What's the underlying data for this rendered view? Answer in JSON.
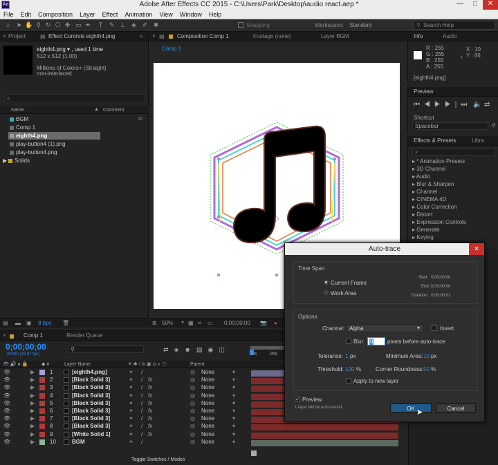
{
  "window": {
    "title": "Adobe After Effects CC 2015 - C:\\Users\\Park\\Desktop\\audio react.aep *",
    "app_icon": "Ae",
    "minimize": "—",
    "maximize": "□",
    "close": "✕"
  },
  "menu": [
    "File",
    "Edit",
    "Composition",
    "Layer",
    "Effect",
    "Animation",
    "View",
    "Window",
    "Help"
  ],
  "toolbar": {
    "snapping": "Snapping",
    "workspace_label": "Workspace:",
    "workspace_value": "Standard",
    "search_placeholder": "Search Help"
  },
  "project_panel": {
    "tabs": [
      "Project",
      "Effect Controls eighth4.png"
    ],
    "file_name": "eighth4.png ▾ , used 1 time",
    "file_dims": "512 x 512 (1.00)",
    "file_color": "Millions of Colors+ (Straight)",
    "file_interlace": "non-interlaced",
    "search_glyph": "⌕",
    "col_name": "Name",
    "col_comment": "Comment",
    "items": [
      {
        "name": "BGM",
        "color": "#3fa8a8"
      },
      {
        "name": "Comp 1",
        "color": "#8a8a8a"
      },
      {
        "name": "eighth4.png",
        "color": "#8a8a8a"
      },
      {
        "name": "play-button4 (1).png",
        "color": "#8a8a8a"
      },
      {
        "name": "play-button4.png",
        "color": "#8a8a8a"
      },
      {
        "name": "Solids",
        "color": "#8a8a8a"
      }
    ],
    "bpc": "8 bpc"
  },
  "comp_panel": {
    "tabs": [
      "Composition Comp 1",
      "Footage (none)",
      "Layer BGM"
    ],
    "breadcrumb": "Comp 1",
    "zoom": "50%",
    "timecode": "0;00;00;00"
  },
  "info_panel": {
    "tabs": [
      "Info",
      "Audio"
    ],
    "r": "R : 255",
    "g": "G : 255",
    "b": "B : 255",
    "a": "A : 255",
    "x": "X : 10",
    "y": "Y : 66",
    "file": "[eighth4.png]"
  },
  "preview_panel": {
    "tab": "Preview",
    "shortcut_label": "Shortcut",
    "shortcut_value": "Spacebar"
  },
  "effects_panel": {
    "tabs": [
      "Effects & Presets",
      "Libra"
    ],
    "search_glyph": "⌕",
    "items": [
      "* Animation Presets",
      "3D Channel",
      "Audio",
      "Blur & Sharpen",
      "Channel",
      "CINEMA 4D",
      "Color Correction",
      "Distort",
      "Expression Controls",
      "Generate",
      "Keying"
    ]
  },
  "timeline": {
    "tabs": [
      "Comp 1",
      "Render Queue"
    ],
    "timecode": "0;00;00;00",
    "fps": "00000 (29.97 fps)",
    "col_layer": "Layer Name",
    "col_parent": "Parent",
    "ruler": [
      "0s",
      "05s"
    ],
    "footer": "Toggle Switches / Modes",
    "layers": [
      {
        "num": "1",
        "name": "[eighth4.png]",
        "color": "#a6a0d8",
        "parent": "None",
        "fx": ""
      },
      {
        "num": "2",
        "name": "[Black Solid 3]",
        "color": "#b03a3a",
        "parent": "None",
        "fx": "fx"
      },
      {
        "num": "3",
        "name": "[Black Solid 3]",
        "color": "#b03a3a",
        "parent": "None",
        "fx": "fx"
      },
      {
        "num": "4",
        "name": "[Black Solid 3]",
        "color": "#b03a3a",
        "parent": "None",
        "fx": "fx"
      },
      {
        "num": "5",
        "name": "[Black Solid 3]",
        "color": "#b03a3a",
        "parent": "None",
        "fx": "fx"
      },
      {
        "num": "6",
        "name": "[Black Solid 3]",
        "color": "#b03a3a",
        "parent": "None",
        "fx": "fx"
      },
      {
        "num": "7",
        "name": "[Black Solid 3]",
        "color": "#b03a3a",
        "parent": "None",
        "fx": "fx"
      },
      {
        "num": "8",
        "name": "[Black Solid 3]",
        "color": "#b03a3a",
        "parent": "None",
        "fx": "fx"
      },
      {
        "num": "9",
        "name": "[White Solid 1]",
        "color": "#b03a3a",
        "parent": "None",
        "fx": "fx"
      },
      {
        "num": "10",
        "name": "BGM",
        "color": "#8ab89a",
        "parent": "None",
        "fx": ""
      }
    ]
  },
  "dialog": {
    "title": "Auto-trace",
    "close": "✕",
    "time_span": "Time Span",
    "current_frame": "Current Frame",
    "work_area": "Work Area",
    "start_label": "Start:",
    "start_value": "0;00;00;00",
    "end_label": "End:",
    "end_value": "0;00;00;00",
    "duration_label": "Duration:",
    "duration_value": "0;00;00;01",
    "options": "Options",
    "channel_label": "Channel:",
    "channel_value": "Alpha",
    "invert": "Invert",
    "blur": "Blur",
    "blur_value": "0",
    "blur_suffix": "pixels before auto-trace",
    "tolerance_label": "Tolerance:",
    "tolerance_value": "1",
    "tolerance_unit": "px",
    "min_area_label": "Minimum Area:",
    "min_area_value": "10",
    "min_area_unit": "px",
    "threshold_label": "Threshold:",
    "threshold_value": "100",
    "threshold_unit": "%",
    "corner_label": "Corner Roundness:",
    "corner_value": "50",
    "corner_unit": "%",
    "apply_new_layer": "Apply to new layer",
    "preview": "Preview",
    "status": "1 layer will be auto-traced.",
    "ok": "OK",
    "cancel": "Cancel"
  },
  "colors": {
    "accent": "#2d8ceb",
    "dialog_ok": "#1f5a8a",
    "track": "#7d2a2a"
  }
}
